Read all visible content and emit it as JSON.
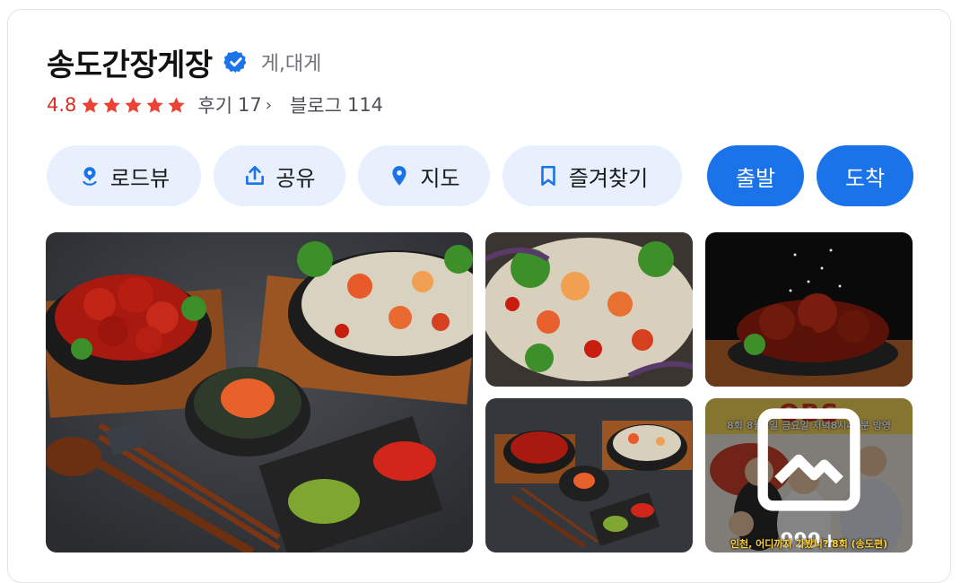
{
  "place": {
    "name": "송도간장게장",
    "category": "게,대게",
    "verified": true
  },
  "rating": {
    "value": "4.8",
    "stars": 5,
    "review_label": "후기",
    "review_count": "17",
    "blog_label": "블로그",
    "blog_count": "114"
  },
  "actions": {
    "roadview": "로드뷰",
    "share": "공유",
    "map": "지도",
    "favorite": "즐겨찾기",
    "depart": "출발",
    "arrive": "도착"
  },
  "photos": {
    "more_count": "999+",
    "obs_logo": "OBS",
    "obs_subtitle": "8회 8월5일 금요일 저녁8시40분 방영",
    "obs_caption": "인천, 어디까지 가봤니? 8회 (송도편)"
  },
  "colors": {
    "accent": "#1a73e8",
    "button_bg": "#e8f0fe",
    "rating": "#d93025",
    "star": "#ea4335"
  }
}
